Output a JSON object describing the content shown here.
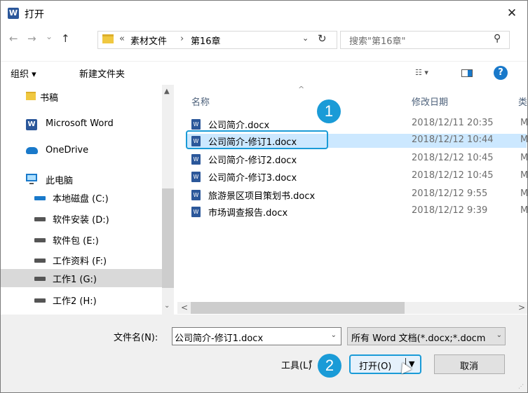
{
  "window": {
    "title": "打开",
    "app_icon": "W",
    "close_glyph": "✕"
  },
  "nav_buttons": {
    "back": "←",
    "forward": "→",
    "recent": "⌄",
    "up": "↑"
  },
  "address": {
    "prefix": "«",
    "crumbs": [
      "素材文件",
      "›",
      "第16章"
    ],
    "dropdown": "⌄",
    "refresh": "↻"
  },
  "search": {
    "placeholder": "搜索\"第16章\"",
    "icon": "⚲"
  },
  "toolbar": {
    "organize": "组织 ▾",
    "new_folder": "新建文件夹",
    "view_glyph": "☷ ▾",
    "help": "?"
  },
  "sidebar": {
    "items": [
      {
        "label": "书稿",
        "icon": "folder-icon"
      },
      {
        "label": "Microsoft Word",
        "icon": "word-icon"
      },
      {
        "label": "OneDrive",
        "icon": "cloud-icon"
      },
      {
        "label": "此电脑",
        "icon": "computer-icon"
      },
      {
        "label": "本地磁盘 (C:)",
        "icon": "system-drive-icon"
      },
      {
        "label": "软件安装 (D:)",
        "icon": "drive-icon"
      },
      {
        "label": "软件包 (E:)",
        "icon": "drive-icon"
      },
      {
        "label": "工作资料 (F:)",
        "icon": "drive-icon"
      },
      {
        "label": "工作1 (G:)",
        "icon": "drive-icon",
        "selected": true
      },
      {
        "label": "工作2 (H:)",
        "icon": "drive-icon"
      }
    ],
    "scroll_up": "▲",
    "scroll_down": "⌄"
  },
  "file_list": {
    "columns": {
      "name": "名称",
      "modified": "修改日期",
      "type": "类"
    },
    "sort_arrow": "^",
    "rows": [
      {
        "name": "公司简介.docx",
        "modified": "2018/12/11  20:35",
        "type": "M"
      },
      {
        "name": "公司简介-修订1.docx",
        "modified": "2018/12/12  10:44",
        "type": "M",
        "selected": true
      },
      {
        "name": "公司简介-修订2.docx",
        "modified": "2018/12/12  10:45",
        "type": "M"
      },
      {
        "name": "公司简介-修订3.docx",
        "modified": "2018/12/12  10:45",
        "type": "M"
      },
      {
        "name": "旅游景区项目策划书.docx",
        "modified": "2018/12/12  9:55",
        "type": "M"
      },
      {
        "name": "市场调查报告.docx",
        "modified": "2018/12/12  9:39",
        "type": "M"
      }
    ],
    "hscroll_left": "<",
    "hscroll_right": ">"
  },
  "annotations": {
    "step1": "1",
    "step2": "2",
    "color": "#1a9bd7"
  },
  "footer": {
    "filename_label": "文件名(N):",
    "filename_value": "公司简介-修订1.docx",
    "filetype_value": "所有 Word 文档(*.docx;*.docm",
    "tools_label": "工具(L)",
    "open_label": "打开(O)",
    "cancel_label": "取消"
  }
}
